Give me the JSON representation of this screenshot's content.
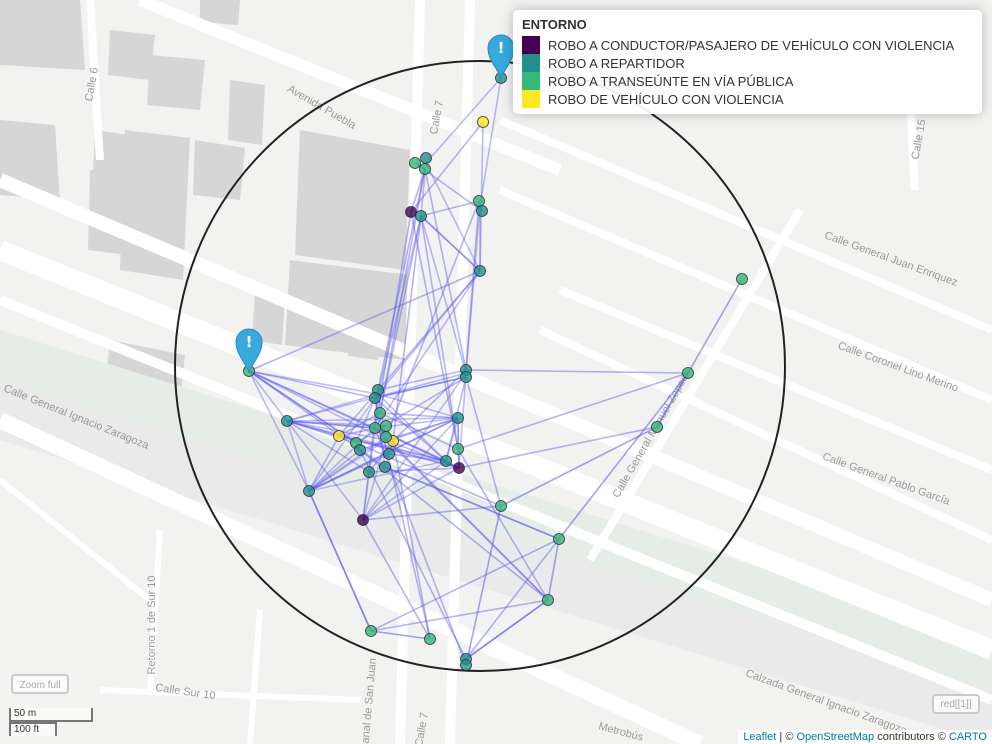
{
  "streets": [
    {
      "label": "Calle 6"
    },
    {
      "label": "Avenida Puebla"
    },
    {
      "label": "Calle 7"
    },
    {
      "label": "Calle 15"
    },
    {
      "label": "Calle General Juan Enriquez"
    },
    {
      "label": "Calle Coronel Lino Merino"
    },
    {
      "label": "Calle General Pablo García"
    },
    {
      "label": "Calle General Manuel Zepeda"
    },
    {
      "label": "Calle General Ignacio Zaragoza"
    },
    {
      "label": "Calzada General Ignacio Zaragoza"
    },
    {
      "label": "Retorno 1 de Sur 10"
    },
    {
      "label": "Calle Sur 10"
    },
    {
      "label": "Canal de San Juan"
    },
    {
      "label": "Calle 7"
    },
    {
      "label": "Metrobús"
    }
  ],
  "legend": {
    "title": "ENTORNO",
    "items": [
      {
        "label": "ROBO A CONDUCTOR/PASAJERO DE VEHÍCULO CON VIOLENCIA",
        "color": "#440154"
      },
      {
        "label": "ROBO A REPARTIDOR",
        "color": "#21908C"
      },
      {
        "label": "ROBO A TRANSEÚNTE EN VÍA PÚBLICA",
        "color": "#35B779"
      },
      {
        "label": "ROBO DE VEHÍCULO CON VIOLENCIA",
        "color": "#FDE725"
      }
    ]
  },
  "markers": [
    {
      "name": "pin-north",
      "icon": "exclamation-pin-icon",
      "color": "#38a9dc"
    },
    {
      "name": "pin-west",
      "icon": "exclamation-pin-icon",
      "color": "#38a9dc"
    }
  ],
  "controls": {
    "zoom_full": "Zoom full",
    "layer_button": "red[[1]]"
  },
  "scale": {
    "metric": "50 m",
    "imperial": "100 ft"
  },
  "attribution": {
    "leaflet": "Leaflet",
    "separator": " | © ",
    "osm": "OpenStreetMap",
    "contributors": " contributors © ",
    "carto": "CARTO"
  }
}
